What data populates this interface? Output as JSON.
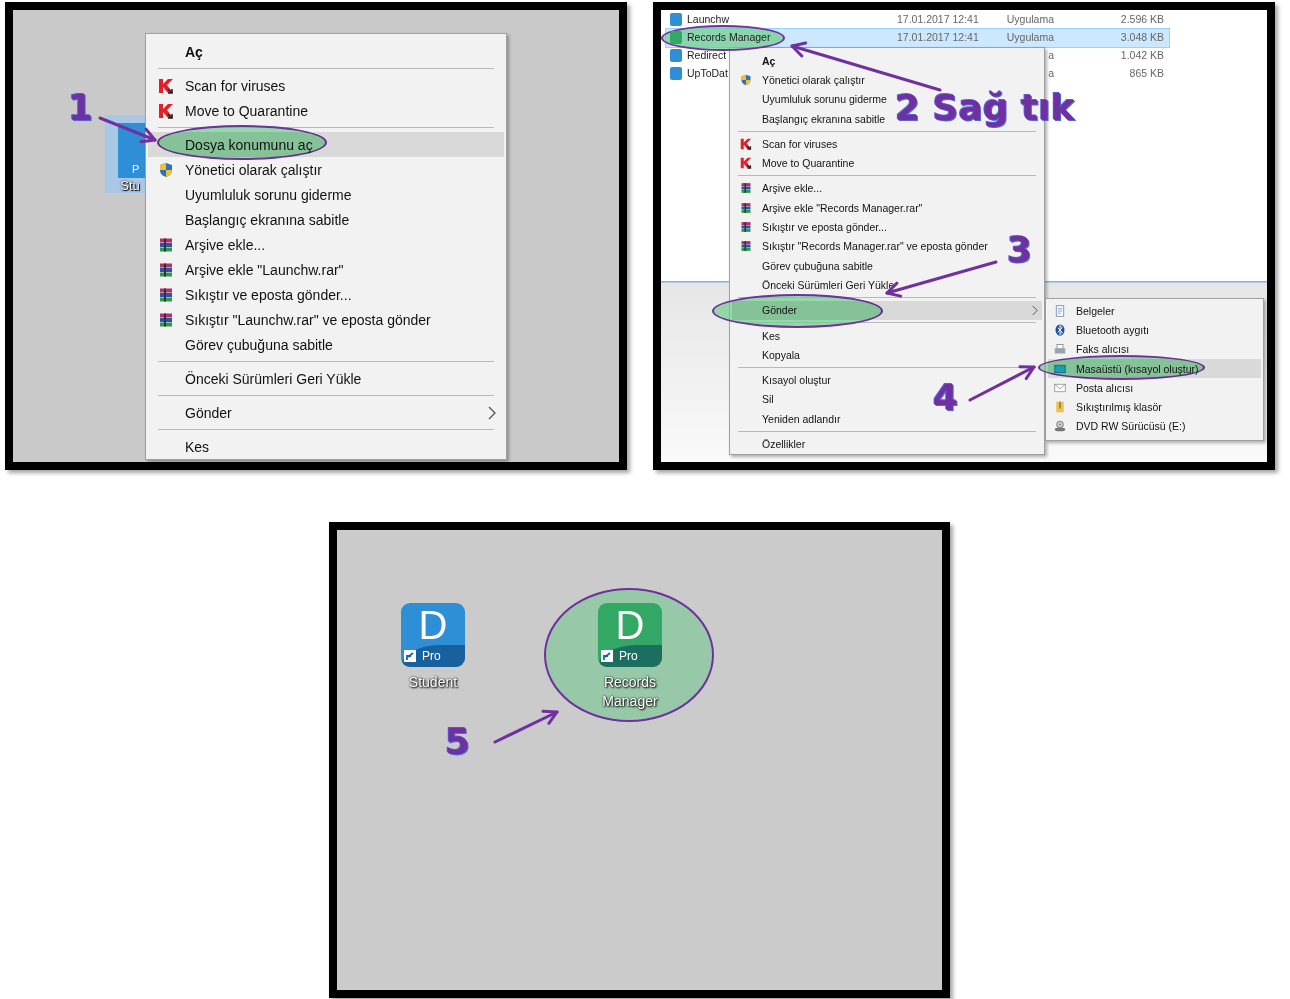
{
  "panel_1": {
    "desktop_icon": {
      "badge": "P",
      "label": "Stu"
    },
    "context_menu": {
      "items": [
        {
          "label": "Aç",
          "kind": "default",
          "selected": false
        },
        {
          "kind": "separator"
        },
        {
          "label": "Scan for viruses",
          "kind": "antivirus",
          "selected": false
        },
        {
          "label": "Move to Quarantine",
          "kind": "antivirus",
          "selected": false
        },
        {
          "kind": "separator"
        },
        {
          "label": "Dosya konumunu aç",
          "kind": "plain",
          "selected": true
        },
        {
          "label": "Yönetici olarak çalıştır",
          "kind": "shield",
          "selected": false
        },
        {
          "label": "Uyumluluk sorunu giderme",
          "kind": "plain",
          "selected": false
        },
        {
          "label": "Başlangıç ekranına sabitle",
          "kind": "plain",
          "selected": false
        },
        {
          "label": "Arşive ekle...",
          "kind": "archive",
          "selected": false
        },
        {
          "label": "Arşive ekle \"Launchw.rar\"",
          "kind": "archive",
          "selected": false
        },
        {
          "label": "Sıkıştır ve eposta gönder...",
          "kind": "archive",
          "selected": false
        },
        {
          "label": "Sıkıştır \"Launchw.rar\" ve eposta gönder",
          "kind": "archive",
          "selected": false
        },
        {
          "label": "Görev çubuğuna sabitle",
          "kind": "plain",
          "selected": false
        },
        {
          "kind": "separator"
        },
        {
          "label": "Önceki Sürümleri Geri Yükle",
          "kind": "plain",
          "selected": false
        },
        {
          "kind": "separator"
        },
        {
          "label": "Gönder",
          "kind": "plain",
          "selected": false,
          "has_submenu": true
        },
        {
          "kind": "separator"
        },
        {
          "label": "Kes",
          "kind": "plain",
          "selected": false
        }
      ]
    },
    "step_label": "1"
  },
  "panel_2": {
    "file_list": {
      "rows": [
        {
          "name": "Launchw",
          "modified": "17.01.2017 12:41",
          "type": "Uygulama",
          "size": "2.596 KB",
          "color": "#2f8fd6",
          "selected": false
        },
        {
          "name": "Records Manager",
          "modified": "17.01.2017 12:41",
          "type": "Uygulama",
          "size": "3.048 KB",
          "color": "#33a865",
          "selected": true
        },
        {
          "name": "Redirect",
          "type": "a",
          "size": "1.042 KB",
          "color": "#2f8fd6",
          "selected": false
        },
        {
          "name": "UpToDat",
          "type": "a",
          "size": "865 KB",
          "color": "#2f8fd6",
          "selected": false
        }
      ]
    },
    "context_menu": {
      "items": [
        {
          "label": "Aç",
          "kind": "default",
          "selected": false
        },
        {
          "label": "Yönetici olarak çalıştır",
          "kind": "shield",
          "selected": false
        },
        {
          "label": "Uyumluluk sorunu giderme",
          "kind": "plain",
          "selected": false
        },
        {
          "label": "Başlangıç ekranına sabitle",
          "kind": "plain",
          "selected": false
        },
        {
          "kind": "separator"
        },
        {
          "label": "Scan for viruses",
          "kind": "antivirus",
          "selected": false
        },
        {
          "label": "Move to Quarantine",
          "kind": "antivirus",
          "selected": false
        },
        {
          "kind": "separator"
        },
        {
          "label": "Arşive ekle...",
          "kind": "archive",
          "selected": false
        },
        {
          "label": "Arşive ekle \"Records Manager.rar\"",
          "kind": "archive",
          "selected": false
        },
        {
          "label": "Sıkıştır ve eposta gönder...",
          "kind": "archive",
          "selected": false
        },
        {
          "label": "Sıkıştır \"Records Manager.rar\" ve eposta gönder",
          "kind": "archive",
          "selected": false
        },
        {
          "label": "Görev çubuğuna sabitle",
          "kind": "plain",
          "selected": false
        },
        {
          "label": "Önceki Sürümleri Geri Yükle",
          "kind": "plain",
          "selected": false
        },
        {
          "kind": "separator"
        },
        {
          "label": "Gönder",
          "kind": "plain",
          "selected": true,
          "has_submenu": true
        },
        {
          "kind": "separator"
        },
        {
          "label": "Kes",
          "kind": "plain",
          "selected": false
        },
        {
          "label": "Kopyala",
          "kind": "plain",
          "selected": false
        },
        {
          "kind": "separator"
        },
        {
          "label": "Kısayol oluştur",
          "kind": "plain",
          "selected": false
        },
        {
          "label": "Sil",
          "kind": "plain",
          "selected": false
        },
        {
          "label": "Yeniden adlandır",
          "kind": "plain",
          "selected": false
        },
        {
          "kind": "separator"
        },
        {
          "label": "Özellikler",
          "kind": "plain",
          "selected": false
        }
      ]
    },
    "submenu": {
      "items": [
        {
          "label": "Belgeler",
          "kind": "document",
          "selected": false
        },
        {
          "label": "Bluetooth aygıtı",
          "kind": "bluetooth",
          "selected": false
        },
        {
          "label": "Faks alıcısı",
          "kind": "fax",
          "selected": false
        },
        {
          "label": "Masaüstü (kısayol oluştur)",
          "kind": "desktop",
          "selected": true
        },
        {
          "label": "Posta alıcısı",
          "kind": "mail",
          "selected": false
        },
        {
          "label": "Sıkıştırılmış klasör",
          "kind": "zip",
          "selected": false
        },
        {
          "label": "DVD RW Sürücüsü (E:)",
          "kind": "dvd",
          "selected": false
        }
      ]
    },
    "step_labels": [
      "2 Sağ tık",
      "3",
      "4"
    ]
  },
  "panel_3": {
    "desktop_icons": [
      {
        "letter": "D",
        "badge": "Pro",
        "label": "Student",
        "color": "#2f8fd6"
      },
      {
        "letter": "D",
        "badge": "Pro",
        "label": "Records Manager",
        "color": "#33a865"
      }
    ],
    "step_label": "5"
  }
}
